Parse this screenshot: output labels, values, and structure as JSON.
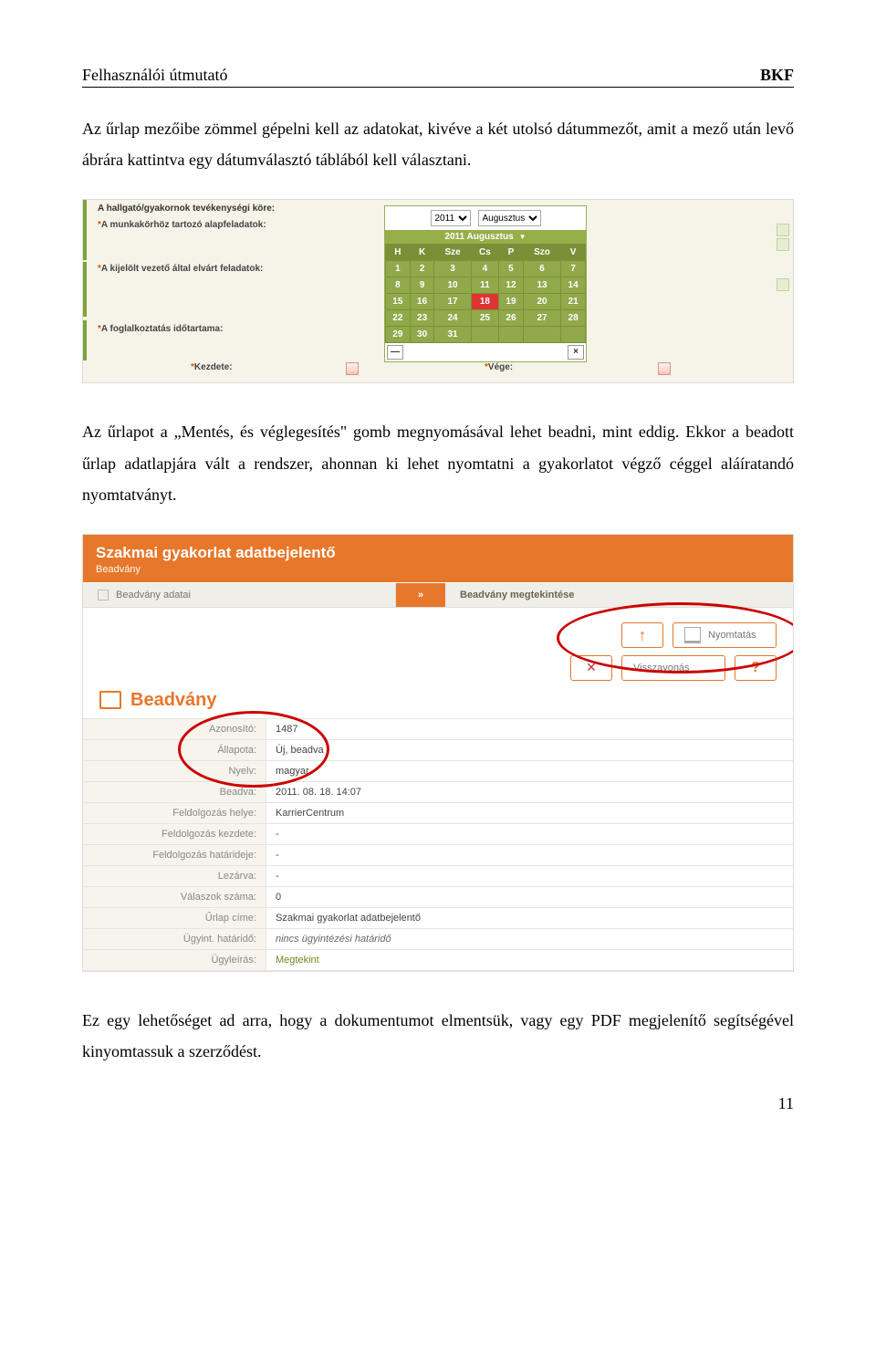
{
  "header": {
    "left": "Felhasználói útmutató",
    "right": "BKF"
  },
  "para1": "Az űrlap mezőibe zömmel gépelni kell az adatokat, kivéve a két utolsó dátummezőt, amit a mező után levő ábrára kattintva egy dátumválasztó táblából kell választani.",
  "para2": "Az űrlapot a „Mentés, és véglegesítés\" gomb megnyomásával lehet beadni, mint eddig. Ekkor a beadott űrlap adatlapjára vált a rendszer, ahonnan ki lehet nyomtatni a gyakorlatot végző céggel aláíratandó nyomtatványt.",
  "para3": "Ez egy lehetőséget ad arra, hogy a dokumentumot elmentsük, vagy egy PDF megjelenítő segítségével kinyomtassuk a szerződést.",
  "pagenum": "11",
  "calendar": {
    "labels": {
      "section": "A hallgató/gyakornok tevékenységi köre:",
      "alap": "A munkakörhöz tartozó alapfeladatok:",
      "elvart": "A kijelölt vezető által elvárt feladatok:",
      "fogl": "A foglalkoztatás időtartama:",
      "kezdete": "Kezdete:",
      "vege": "Vége:"
    },
    "star": "*",
    "year": "2011",
    "month": "Augusztus",
    "title": "2011 Augusztus",
    "dow": [
      "H",
      "K",
      "Sze",
      "Cs",
      "P",
      "Szo",
      "V"
    ],
    "weeks": [
      [
        "1",
        "2",
        "3",
        "4",
        "5",
        "6",
        "7"
      ],
      [
        "8",
        "9",
        "10",
        "11",
        "12",
        "13",
        "14"
      ],
      [
        "15",
        "16",
        "17",
        "18",
        "19",
        "20",
        "21"
      ],
      [
        "22",
        "23",
        "24",
        "25",
        "26",
        "27",
        "28"
      ],
      [
        "29",
        "30",
        "31",
        "",
        "",
        "",
        ""
      ]
    ],
    "today": "18",
    "minus": "—",
    "close": "×"
  },
  "beadvany": {
    "title": "Szakmai gyakorlat adatbejelentő",
    "subtitle": "Beadvány",
    "tab1": "Beadvány adatai",
    "tabdiv": "»",
    "tab2": "Beadvány megtekintése",
    "actions": {
      "up": "↑",
      "print": "Nyomtatás",
      "withdraw": "Visszavonás",
      "help": "?",
      "x": "✕"
    },
    "section": "Beadvány",
    "rows": [
      {
        "k": "Azonosító:",
        "v": "1487"
      },
      {
        "k": "Állapota:",
        "v": "Új, beadva"
      },
      {
        "k": "Nyelv:",
        "v": "magyar"
      },
      {
        "k": "Beadva:",
        "v": "2011. 08. 18. 14:07"
      },
      {
        "k": "Feldolgozás helye:",
        "v": "KarrierCentrum"
      },
      {
        "k": "Feldolgozás kezdete:",
        "v": "-"
      },
      {
        "k": "Feldolgozás határideje:",
        "v": "-"
      },
      {
        "k": "Lezárva:",
        "v": "-"
      },
      {
        "k": "Válaszok száma:",
        "v": "0"
      },
      {
        "k": "Űrlap címe:",
        "v": "Szakmai gyakorlat adatbejelentő"
      },
      {
        "k": "Ügyint. határidő:",
        "v": "nincs ügyintézési határidő",
        "em": true
      },
      {
        "k": "Ügyleírás:",
        "v": "Megtekint",
        "link": true
      }
    ]
  }
}
